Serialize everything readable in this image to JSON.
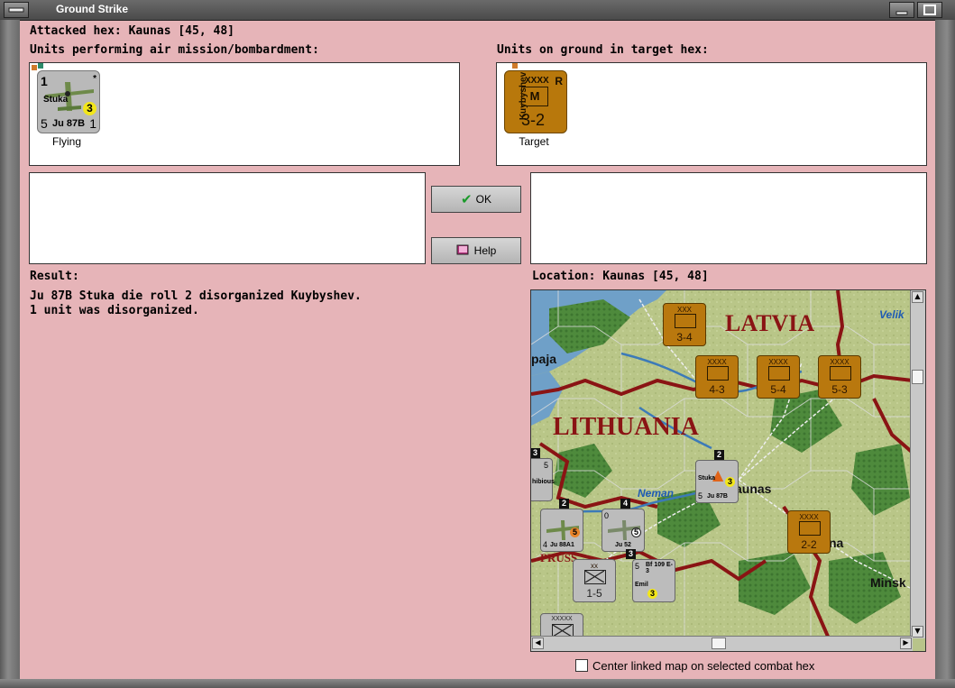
{
  "window": {
    "title": "Ground Strike"
  },
  "header": {
    "attacked_hex": "Attacked hex: Kaunas  [45, 48]"
  },
  "air_panel": {
    "label": "Units performing air mission/bombardment:",
    "unit": {
      "top_left": "1",
      "star": "*",
      "name": "Stuka",
      "circle": "3",
      "bottom_left": "5",
      "type": "Ju 87B",
      "bottom_right": "1",
      "caption": "Flying"
    }
  },
  "ground_panel": {
    "label": "Units on ground in target hex:",
    "unit": {
      "side_name": "Kuybyshev",
      "size": "XXXX",
      "flag": "R",
      "symbol": "M",
      "strength": "3-2",
      "caption": "Target"
    }
  },
  "buttons": {
    "ok": "OK",
    "help": "Help"
  },
  "result": {
    "label": "Result:",
    "lines": [
      "Ju 87B Stuka die roll 2 disorganized Kuybyshev.",
      "1 unit was disorganized."
    ]
  },
  "location": {
    "label": "Location:  Kaunas  [45, 48]"
  },
  "map": {
    "regions": {
      "latvia": "LATVIA",
      "lithuania": "LITHUANIA"
    },
    "places": {
      "paja": "paja",
      "velik": "Velik",
      "neman": "Neman",
      "kaunas": "aunas",
      "prussia": "PRUSS",
      "minsk": "Minsk",
      "na": "na"
    },
    "counters": {
      "c1": {
        "size": "XXX",
        "strength": "3-4"
      },
      "c2": {
        "size": "XXXX",
        "strength": "4-3"
      },
      "c3": {
        "size": "XXXX",
        "strength": "5-4"
      },
      "c4": {
        "size": "XXXX",
        "strength": "5-3"
      },
      "c5": {
        "size": "XXXX",
        "strength": "2-2"
      },
      "c6": {
        "size": "xx",
        "strength": "1-5"
      },
      "stuka": {
        "stack": "2",
        "name": "Stuka",
        "type": "Ju 87B",
        "num": "5",
        "circle": "3"
      },
      "ju88": {
        "stack": "2",
        "type": "Ju 88A1",
        "num": "4",
        "circle": "5"
      },
      "ju52": {
        "stack": "4",
        "type": "Ju 52",
        "num": "0",
        "circle": "5"
      },
      "bf109": {
        "stack": "3",
        "type": "Bf 109 E-3",
        "name": "Emil",
        "num": "5",
        "circle": "3"
      },
      "edge": {
        "stack": "3",
        "name": "hibious",
        "num": "5"
      },
      "edge2": {
        "size": "XXXXX"
      }
    },
    "colors": {
      "terrain": "#b7c487",
      "forest": "#4f8a3e",
      "border": "#8a1414",
      "water": "#3c7ab8",
      "counter": "#b9780e"
    }
  },
  "footer": {
    "checkbox_label": "Center linked map on selected combat hex",
    "checked": false
  }
}
